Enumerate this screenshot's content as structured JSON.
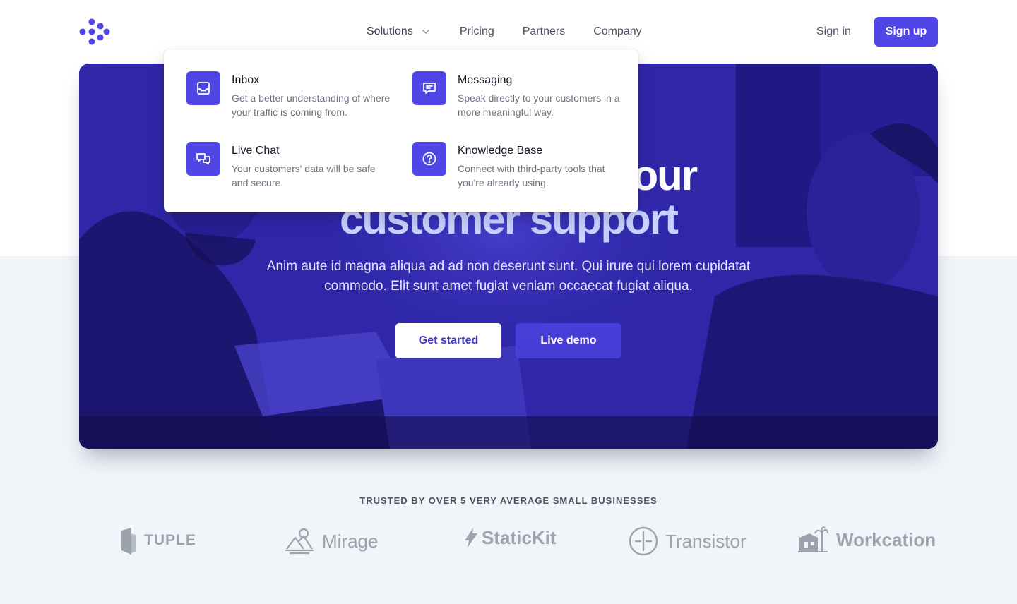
{
  "nav": {
    "items": [
      {
        "label": "Solutions",
        "has_dropdown": true
      },
      {
        "label": "Pricing"
      },
      {
        "label": "Partners"
      },
      {
        "label": "Company"
      }
    ],
    "sign_in": "Sign in",
    "sign_up": "Sign up"
  },
  "dropdown": {
    "items": [
      {
        "title": "Inbox",
        "desc": "Get a better understanding of where your traffic is coming from.",
        "icon": "inbox-icon"
      },
      {
        "title": "Messaging",
        "desc": "Speak directly to your customers in a more meaningful way.",
        "icon": "message-icon"
      },
      {
        "title": "Live Chat",
        "desc": "Your customers' data will be safe and secure.",
        "icon": "chat-icon"
      },
      {
        "title": "Knowledge Base",
        "desc": "Connect with third-party tools that you're already using.",
        "icon": "question-icon"
      }
    ]
  },
  "hero": {
    "title_line1": "Take control of your",
    "title_line2": "customer support",
    "description": "Anim aute id magna aliqua ad ad non deserunt sunt. Qui irure qui lorem cupidatat commodo. Elit sunt amet fugiat veniam occaecat fugiat aliqua.",
    "primary_button": "Get started",
    "secondary_button": "Live demo"
  },
  "trusted": {
    "label": "TRUSTED BY OVER 5 VERY AVERAGE SMALL BUSINESSES",
    "logos": [
      {
        "name": "TUPLE",
        "icon": "tuple-logo"
      },
      {
        "name": "Mirage",
        "icon": "mirage-logo"
      },
      {
        "name": "StaticKit",
        "icon": "statickit-logo"
      },
      {
        "name": "Transistor",
        "icon": "transistor-logo"
      },
      {
        "name": "Workcation",
        "icon": "workcation-logo"
      }
    ]
  },
  "colors": {
    "accent": "#4f46e5",
    "hero_overlay": "#3730a3",
    "page_bg": "#f1f4f8"
  }
}
